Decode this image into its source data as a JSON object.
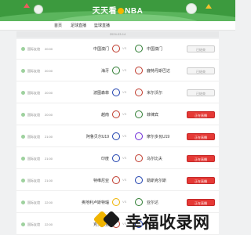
{
  "site": {
    "title_a": "天天看",
    "title_b": "NBA"
  },
  "nav": [
    {
      "label": "首页"
    },
    {
      "label": "足球直播"
    },
    {
      "label": "篮球直播"
    }
  ],
  "date_bar": "2024-03-14",
  "matches": [
    {
      "league": "国际友谊",
      "time": "20:00",
      "home": "中国澳门",
      "away": "中国澳门",
      "status": "已结束",
      "state": "ended",
      "home_color": "#c0392b",
      "away_color": "#2e7d32"
    },
    {
      "league": "国际友谊",
      "time": "20:00",
      "home": "海牙",
      "away": "鹿特丹斯巴达",
      "status": "已结束",
      "state": "ended",
      "home_color": "#2e7d32",
      "away_color": "#c0392b"
    },
    {
      "league": "国际友谊",
      "time": "20:00",
      "home": "波图森菲",
      "away": "米尔沃尔",
      "status": "已结束",
      "state": "ended",
      "home_color": "#1e40af",
      "away_color": "#c0392b"
    },
    {
      "league": "国际友谊",
      "time": "20:00",
      "home": "越南",
      "away": "菲律宾",
      "status": "正在直播",
      "state": "live",
      "home_color": "#c0392b",
      "away_color": "#2e7d32"
    },
    {
      "league": "国际友谊",
      "time": "21:00",
      "home": "阿鲁贝尔U19",
      "away": "摩尔多瓦U19",
      "status": "正在直播",
      "state": "live",
      "home_color": "#1e40af",
      "away_color": "#6d28d9"
    },
    {
      "league": "国际友谊",
      "time": "21:00",
      "home": "印度",
      "away": "乌尔比夫",
      "status": "正在直播",
      "state": "live",
      "home_color": "#1e40af",
      "away_color": "#c0392b"
    },
    {
      "league": "国际友谊",
      "time": "21:00",
      "home": "特维尼亚",
      "away": "勒斯克尔斯",
      "status": "正在直播",
      "state": "live",
      "home_color": "#c0392b",
      "away_color": "#1e40af"
    },
    {
      "league": "国际友谊",
      "time": "22:00",
      "home": "奥地利卢斯特瑙",
      "away": "亚尔达",
      "status": "正在直播",
      "state": "live",
      "home_color": "#f0b400",
      "away_color": "#2e7d32"
    },
    {
      "league": "国际友谊",
      "time": "22:00",
      "home": "克罗地亚",
      "away": "",
      "status": "",
      "state": "ended",
      "home_color": "#c0392b",
      "away_color": "#1e40af"
    }
  ],
  "vs_label": "VS",
  "watermark": {
    "text": "幸福收录网"
  }
}
